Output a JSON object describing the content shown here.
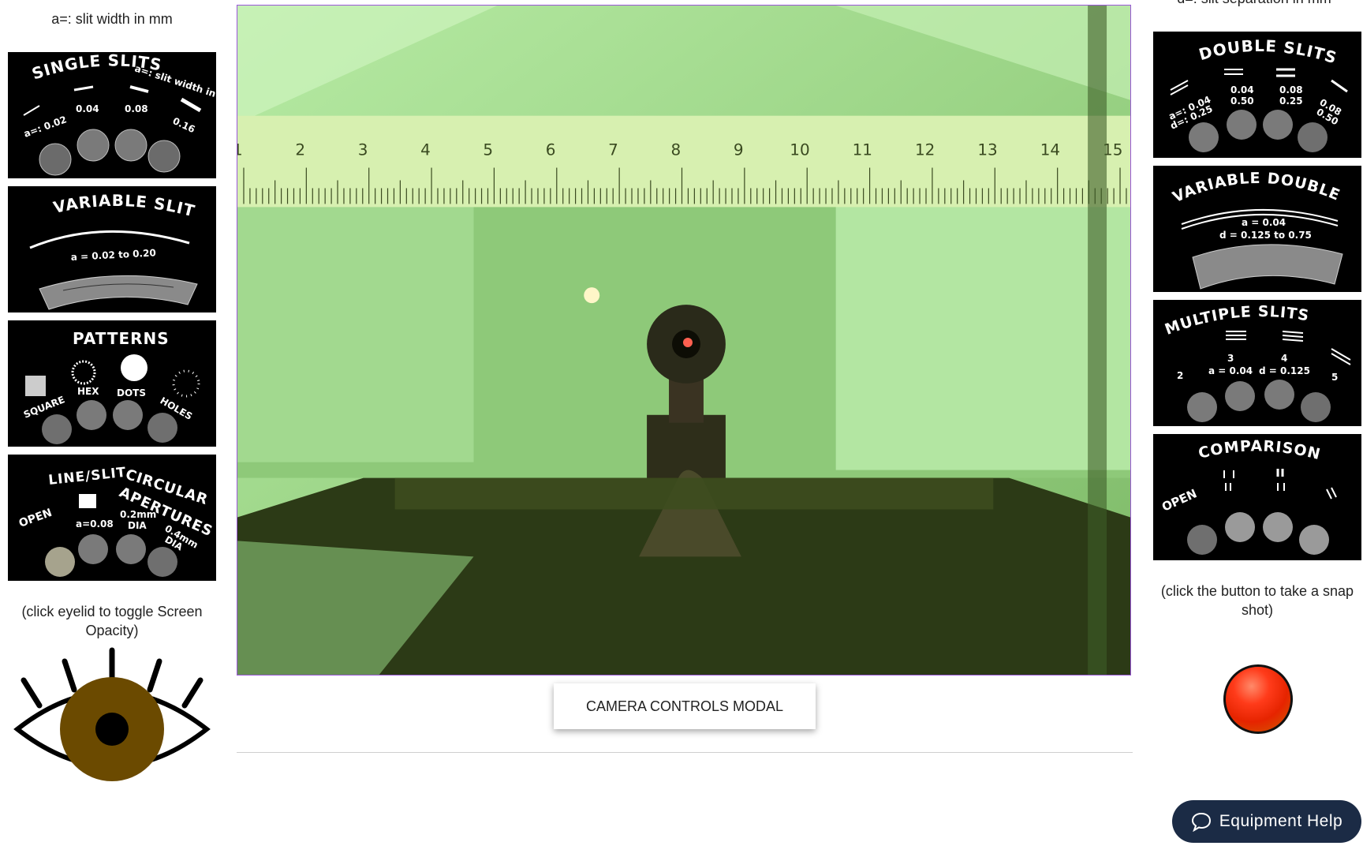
{
  "left_caption": "a=: slit width in mm",
  "right_caption": "d=: slit separation in mm",
  "wheels_left": [
    {
      "id": "single-slits",
      "title": "SINGLE SLITS",
      "note": "a=: slit width in mm",
      "labels": [
        "a=: 0.02",
        "0.04",
        "0.08",
        "0.16"
      ]
    },
    {
      "id": "variable-slit",
      "title": "VARIABLE SLIT",
      "labels": [
        "a = 0.02 to 0.20"
      ]
    },
    {
      "id": "patterns",
      "title": "PATTERNS",
      "labels": [
        "SQUARE",
        "HEX",
        "DOTS",
        "HOLES"
      ]
    },
    {
      "id": "line-slit-circular",
      "title": "LINE/SLIT",
      "title2": "CIRCULAR",
      "title3": "APERTURES",
      "labels": [
        "OPEN",
        "a=0.08",
        "0.2mm",
        "DIA",
        "0.4mm",
        "DIA"
      ]
    }
  ],
  "wheels_right": [
    {
      "id": "double-slits",
      "title": "DOUBLE SLITS",
      "labels": [
        "a=: 0.04",
        "d=: 0.25",
        "0.04",
        "0.50",
        "0.08",
        "0.25",
        "0.08",
        "0.50"
      ]
    },
    {
      "id": "variable-double-slit",
      "title": "VARIABLE DOUBLE SLIT",
      "labels": [
        "a = 0.04",
        "d = 0.125 to 0.75"
      ]
    },
    {
      "id": "multiple-slits",
      "title": "MULTIPLE SLITS",
      "labels": [
        "2",
        "3",
        "a = 0.04",
        "4",
        "d = 0.125",
        "5"
      ]
    },
    {
      "id": "comparisons",
      "title": "COMPARISONS",
      "labels": [
        "OPEN"
      ]
    }
  ],
  "eyelid_caption": "(click eyelid to toggle Screen Opacity)",
  "snapshot_caption": "(click the button to take a snap shot)",
  "camera": {
    "ruler_numbers": [
      "1",
      "2",
      "3",
      "4",
      "5",
      "6",
      "7",
      "8",
      "9",
      "10",
      "11",
      "12",
      "13",
      "14",
      "15"
    ]
  },
  "camera_controls_label": "CAMERA CONTROLS MODAL",
  "help_label": "Equipment Help",
  "colors": {
    "eye_iris": "#6b4a00",
    "snapshot_button": "#ff3b1a",
    "help_button_bg": "#1b2b45",
    "camera_border": "#9a57d9"
  }
}
